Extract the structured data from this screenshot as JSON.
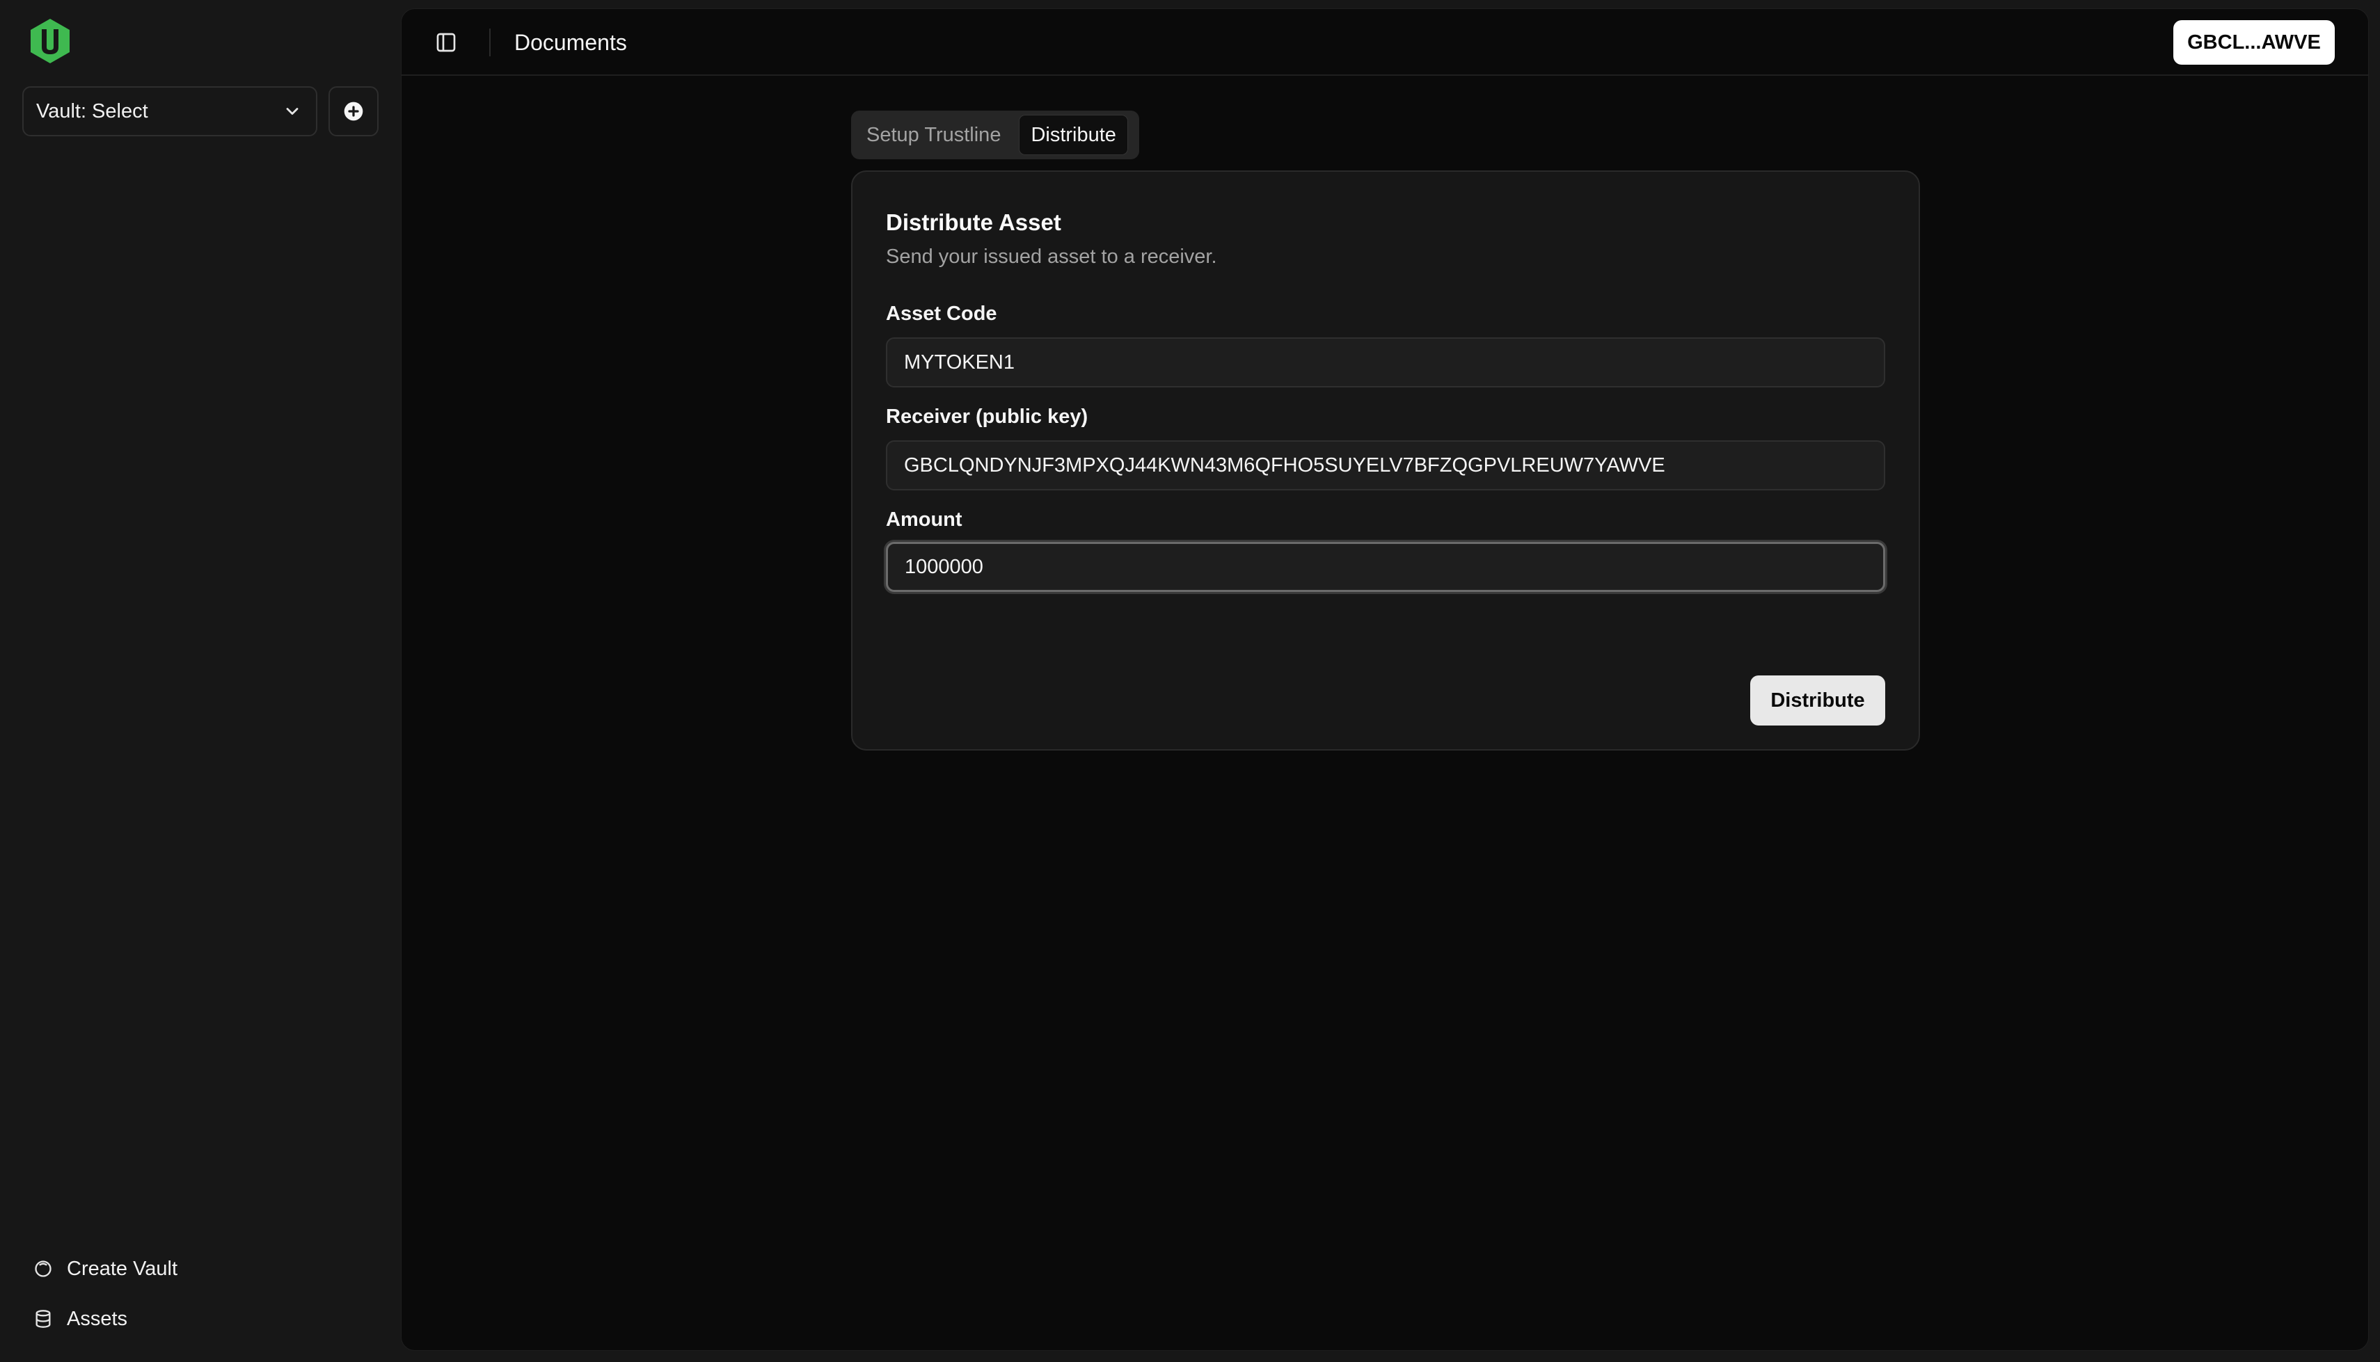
{
  "sidebar": {
    "logo_icon": "hexagon-u-logo-icon",
    "vault_select": {
      "label": "Vault: Select"
    },
    "add_vault_icon": "plus-circle-icon",
    "nav": [
      {
        "label": "Create Vault",
        "icon": "vault-circle-icon"
      },
      {
        "label": "Assets",
        "icon": "database-icon"
      }
    ]
  },
  "header": {
    "title": "Documents",
    "account": "GBCL...AWVE"
  },
  "tabs": [
    {
      "label": "Setup Trustline",
      "active": false
    },
    {
      "label": "Distribute",
      "active": true
    }
  ],
  "form": {
    "title": "Distribute Asset",
    "description": "Send your issued asset to a receiver.",
    "asset_code": {
      "label": "Asset Code",
      "value": "MYTOKEN1"
    },
    "receiver": {
      "label": "Receiver (public key)",
      "value": "GBCLQNDYNJF3MPXQJ44KWN43M6QFHO5SUYELV7BFZQGPVLREUW7YAWVE"
    },
    "amount": {
      "label": "Amount",
      "value": "1000000"
    },
    "submit_label": "Distribute"
  },
  "colors": {
    "brand": "#3fb950",
    "background": "#171717",
    "panel": "#0a0a0a"
  }
}
